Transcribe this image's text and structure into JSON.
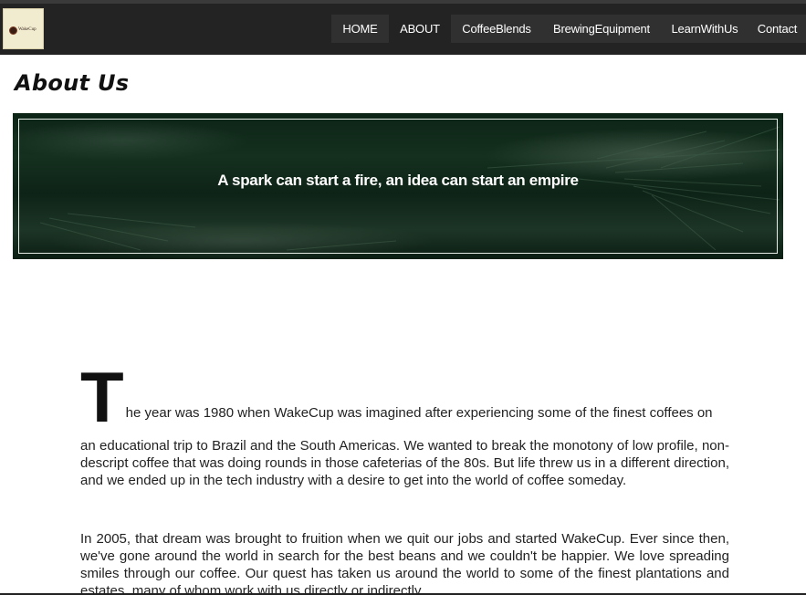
{
  "site": {
    "logo_text": "WakeCup"
  },
  "nav": {
    "items": [
      {
        "label": "HOME"
      },
      {
        "label": "ABOUT"
      },
      {
        "label": "CoffeeBlends"
      },
      {
        "label": "BrewingEquipment"
      },
      {
        "label": "LearnWithUs"
      },
      {
        "label": "Contact"
      }
    ],
    "active": "ABOUT"
  },
  "page": {
    "title": "About Us"
  },
  "banner": {
    "quote": "A spark can start a fire, an idea can start an empire"
  },
  "story": {
    "drop_cap": "T",
    "para1_first_line": "he year was 1980 when WakeCup was imagined after experiencing some of the finest coffees on",
    "para1_rest": "an educational trip to Brazil and the South Americas. We wanted to break the monotony of low profile, non-descript coffee that was doing rounds in those cafeterias of the 80s. But life threw us in a different direction, and we ended up in the tech industry with a desire to get into the world of coffee someday.",
    "para2": "In 2005, that dream was brought to fruition when we quit our jobs and started WakeCup. Ever since then, we've gone around the world in search for the best beans and we couldn't be happier. We love spreading smiles through our coffee. Our quest has taken us around the world to some of the finest plantations and estates, many of whom work with us directly or indirectly."
  },
  "colors": {
    "nav_background": "#232323",
    "nav_item_background": "#303030",
    "banner_green": "#0d2317",
    "banner_frame": "#e6ece6",
    "text": "#222222"
  }
}
